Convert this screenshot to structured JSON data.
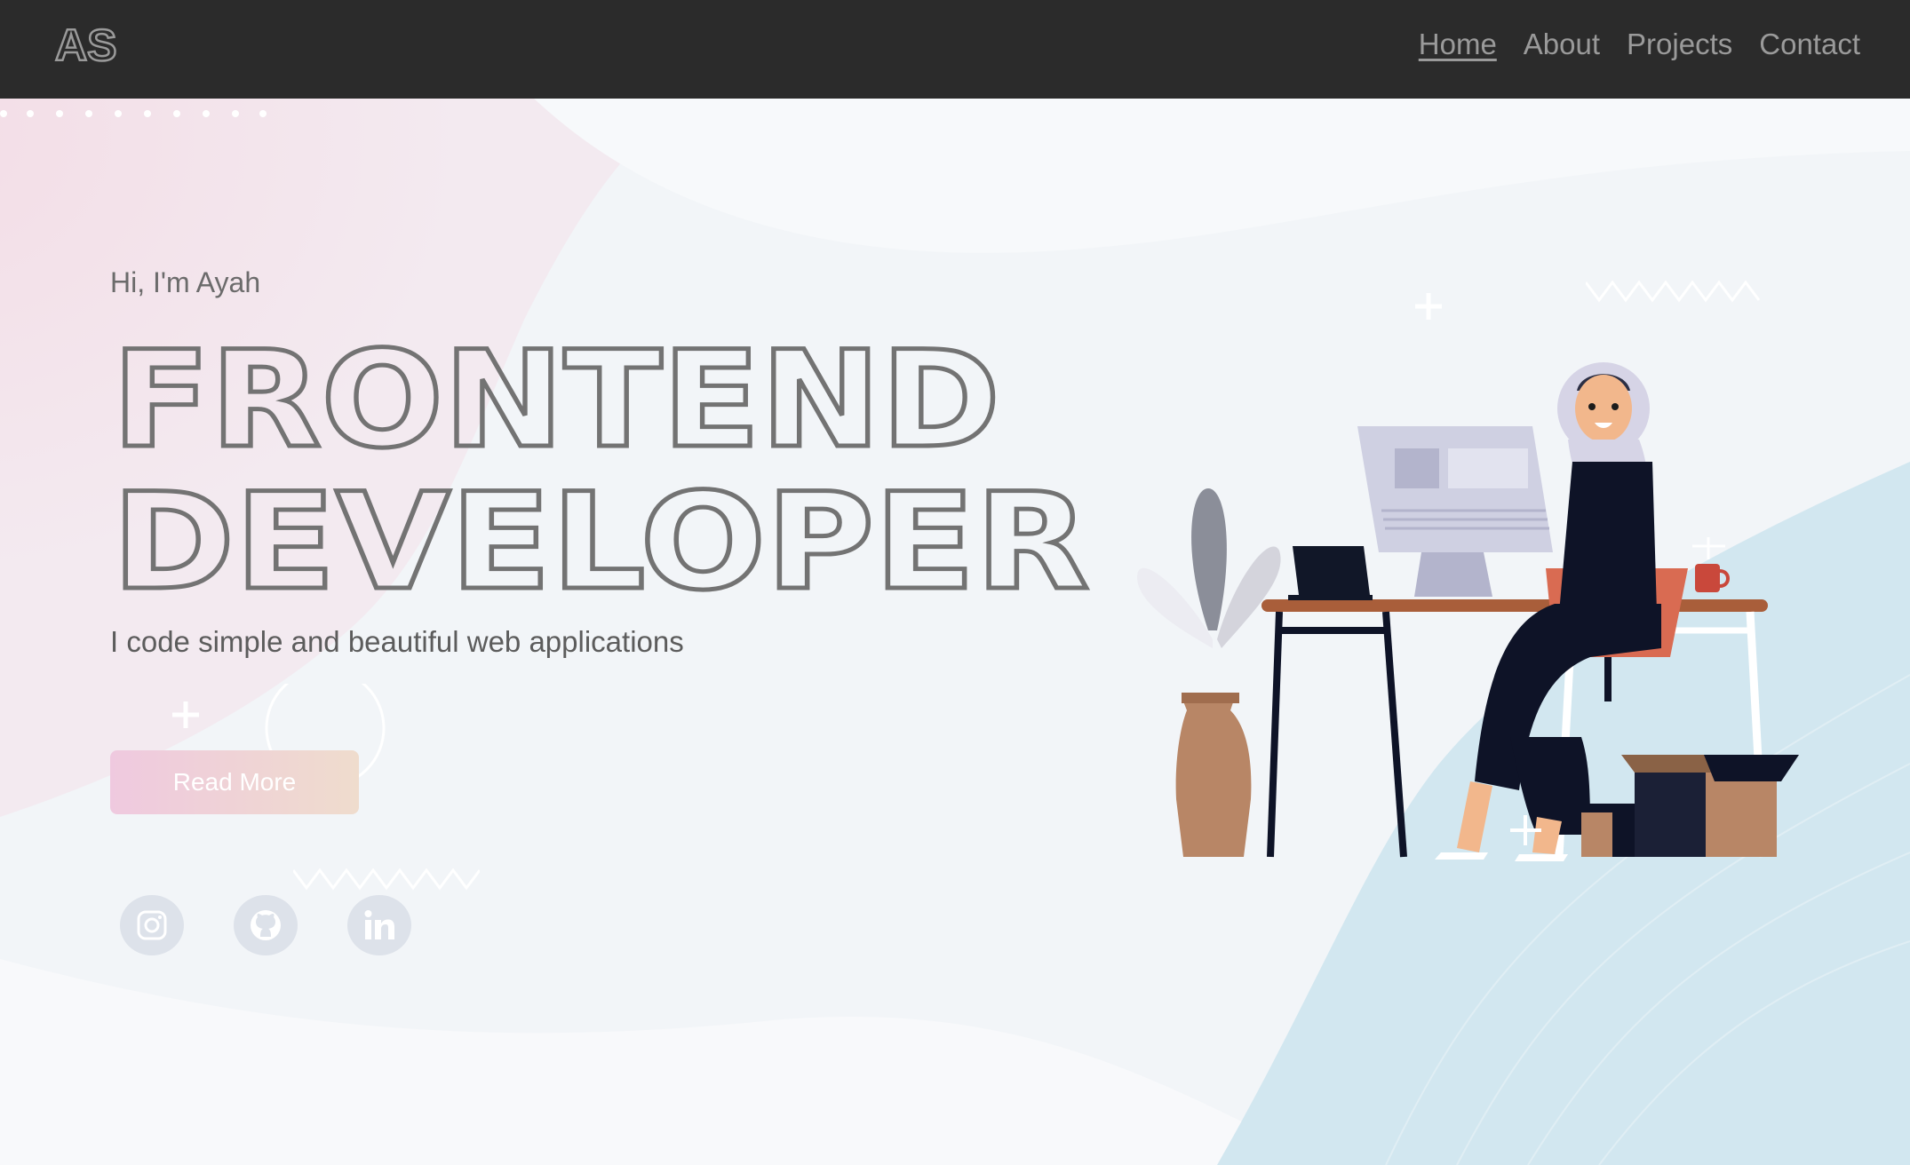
{
  "logo": {
    "text": "AS"
  },
  "nav": {
    "items": [
      {
        "label": "Home",
        "active": true
      },
      {
        "label": "About",
        "active": false
      },
      {
        "label": "Projects",
        "active": false
      },
      {
        "label": "Contact",
        "active": false
      }
    ]
  },
  "hero": {
    "greeting": "Hi, I'm Ayah",
    "headline_line1": "FRONTEND",
    "headline_line2": "DEVELOPER",
    "tagline": "I code simple and beautiful web applications",
    "cta_label": "Read More"
  },
  "social": [
    {
      "icon": "instagram-icon"
    },
    {
      "icon": "github-icon"
    },
    {
      "icon": "linkedin-icon"
    }
  ],
  "colors": {
    "navbar_bg": "#2b2b2b",
    "nav_text": "#9a9a9a",
    "headline": "#737373",
    "cta_gradient_start": "#efc9df",
    "cta_gradient_end": "#efdccd",
    "social_circle": "#dde2ea",
    "blue_wave": "#d2e7f0"
  }
}
